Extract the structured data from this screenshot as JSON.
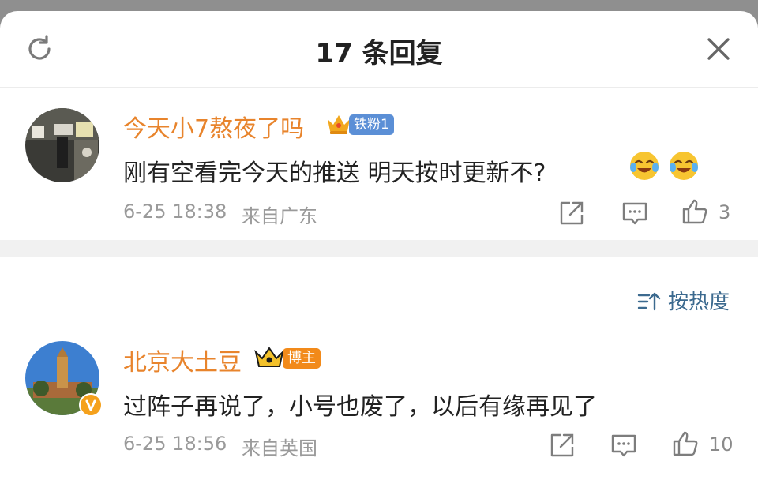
{
  "header": {
    "title": "17 条回复"
  },
  "comments": [
    {
      "username": "今天小7熬夜了吗",
      "badge": "铁粉1",
      "text": "刚有空看完今天的推送 明天按时更新不?",
      "date": "6-25 18:38",
      "location": "来自广东",
      "likes": "3",
      "emoji": [
        "laughing-crying-emoji",
        "laughing-crying-emoji"
      ]
    },
    {
      "username": "北京大土豆",
      "badge": "博主",
      "text": "过阵子再说了，小号也废了，以后有缘再见了",
      "date": "6-25 18:56",
      "location": "来自英国",
      "likes": "10"
    }
  ],
  "sort": {
    "label": "按热度"
  },
  "colors": {
    "username": "#e8842c",
    "fan_badge": "#5b8fd6",
    "blogger_badge": "#f28a1a",
    "sort_link": "#3c6a8f",
    "verified_badge": "#f5a11c"
  }
}
